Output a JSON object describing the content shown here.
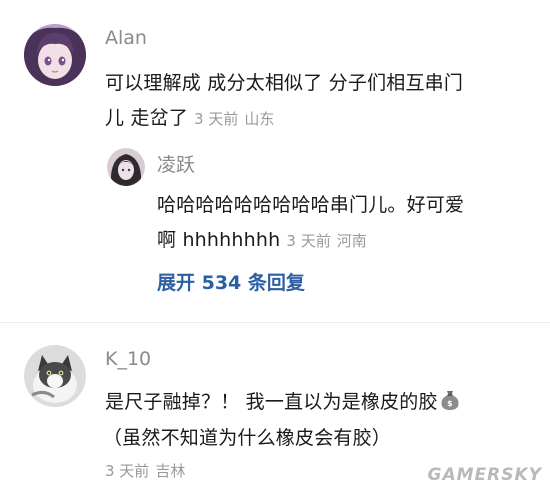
{
  "comments": [
    {
      "user": "Alan",
      "text_line1": "可以理解成 成分太相似了 分子们相互串门",
      "text_line2": "儿 走岔了",
      "time": "3 天前",
      "location": "山东",
      "reply": {
        "user": "凌跃",
        "text_line1": "哈哈哈哈哈哈哈哈哈串门儿。好可爱",
        "text_line2": "啊 hhhhhhhh",
        "time": "3 天前",
        "location": "河南"
      },
      "expand_label": "展开 534 条回复"
    },
    {
      "user": "K_10",
      "text_line1": "是尺子融掉？！ 我一直以为是橡皮的胶",
      "emoji_icon": "money-bag-icon",
      "text_line2": "（虽然不知道为什么橡皮会有胶）",
      "time": "3 天前",
      "location": "吉林"
    }
  ],
  "watermark": "GAMERSKY",
  "colors": {
    "username": "#8a8a8a",
    "body_text": "#1a1a1a",
    "meta": "#9a9a9a",
    "expand_link": "#2b5ea3"
  }
}
